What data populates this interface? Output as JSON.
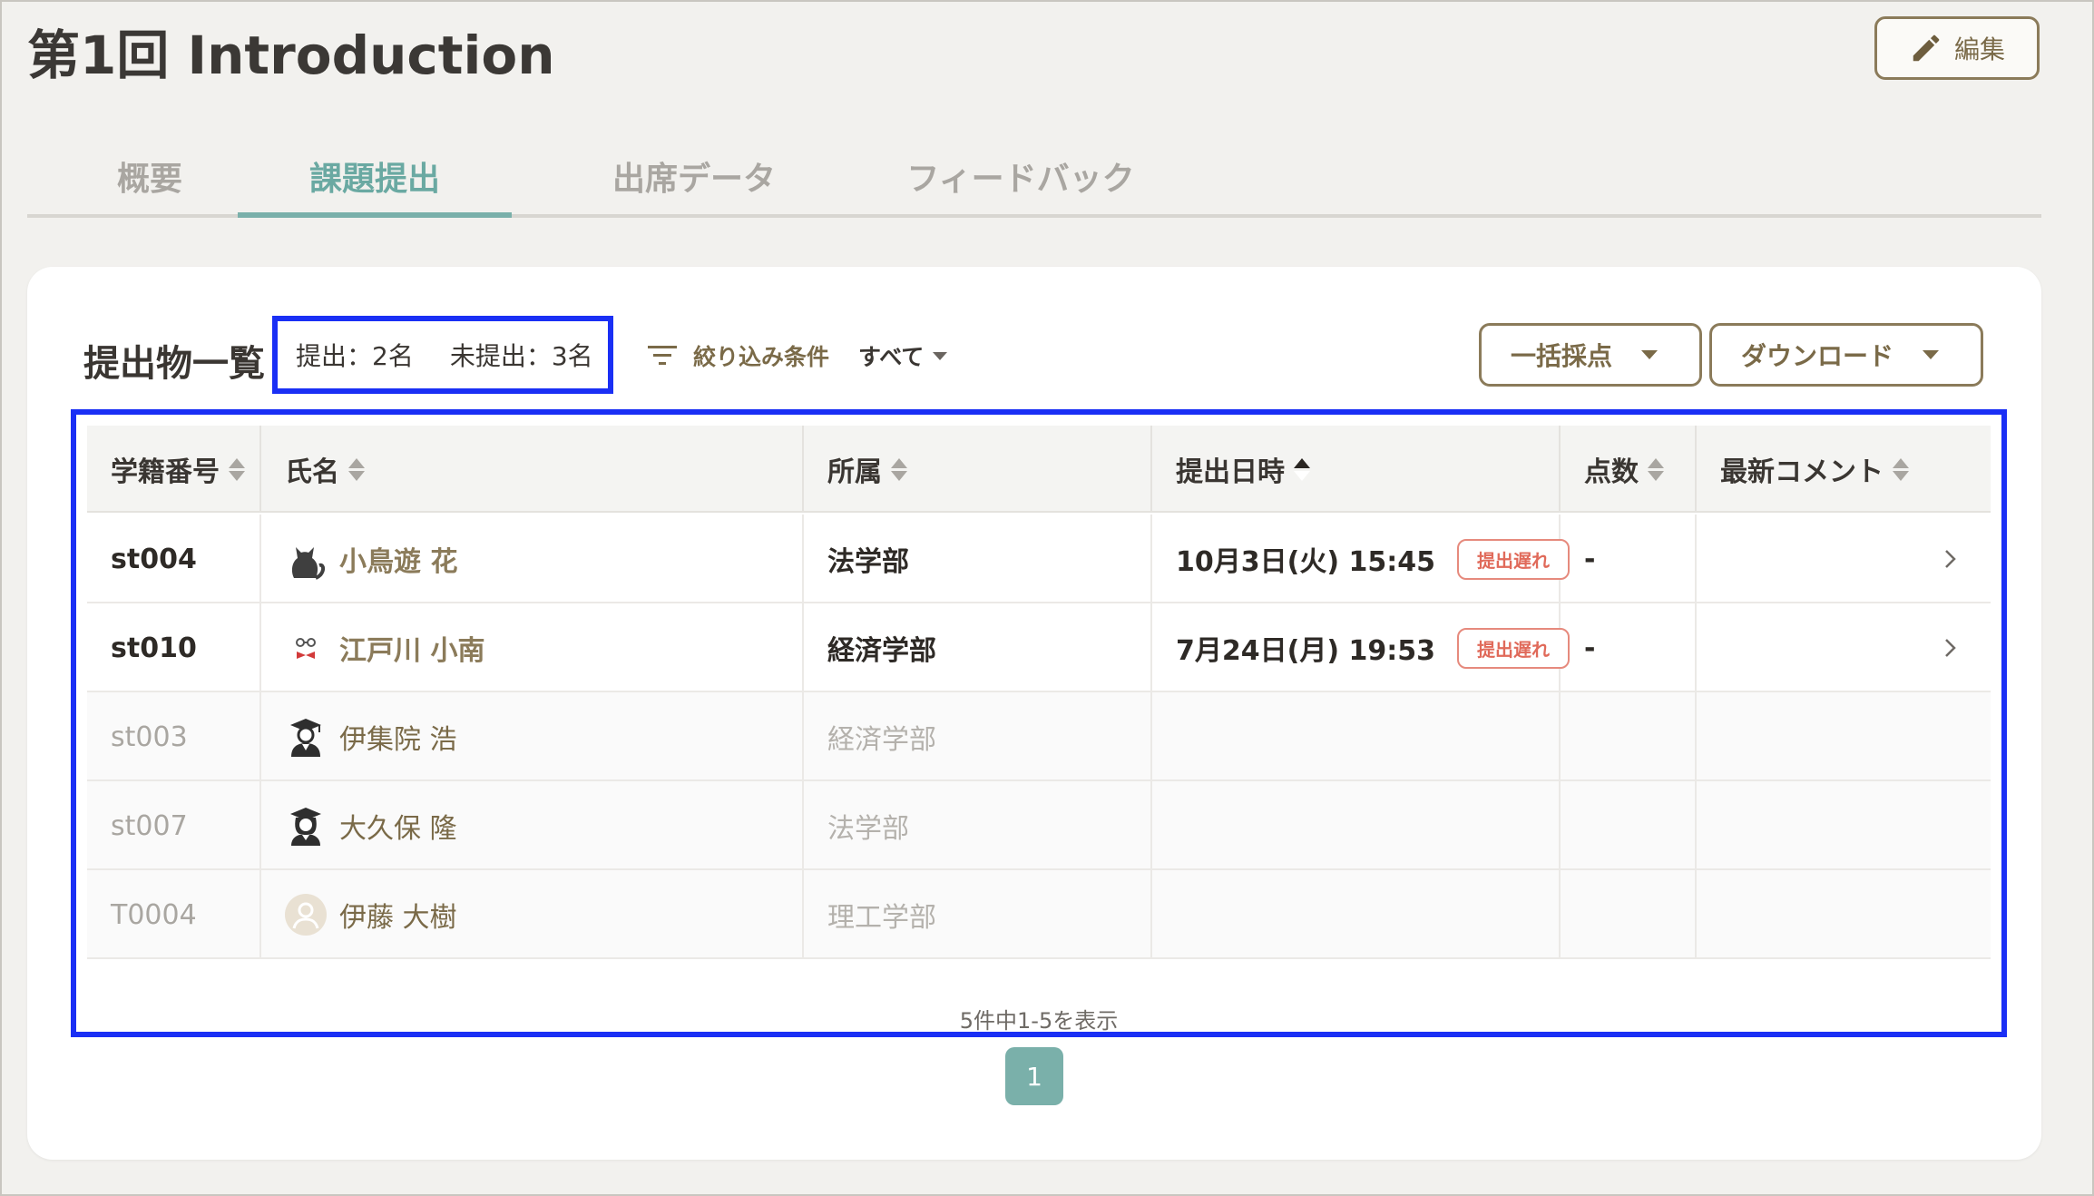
{
  "page": {
    "title": "第1回 Introduction",
    "edit_label": "編集"
  },
  "tabs": [
    {
      "label": "概要"
    },
    {
      "label": "課題提出"
    },
    {
      "label": "出席データ"
    },
    {
      "label": "フィードバック"
    }
  ],
  "list": {
    "title": "提出物一覧",
    "submitted": "提出：2名",
    "not_submitted": "未提出：3名",
    "filter_label": "絞り込み条件",
    "filter_value": "すべて",
    "bulk_grade_label": "一括採点",
    "download_label": "ダウンロード"
  },
  "table": {
    "columns": [
      "学籍番号",
      "氏名",
      "所属",
      "提出日時",
      "点数",
      "最新コメント"
    ],
    "rows": [
      {
        "id": "st004",
        "name": "小鳥遊 花",
        "dept": "法学部",
        "date": "10月3日(火) 15:45",
        "badge": "提出遅れ",
        "score": "-",
        "submitted": true,
        "avatar": "cat-icon"
      },
      {
        "id": "st010",
        "name": "江戸川 小南",
        "dept": "経済学部",
        "date": "7月24日(月) 19:53",
        "badge": "提出遅れ",
        "score": "-",
        "submitted": true,
        "avatar": "glasses-bowtie-icon"
      },
      {
        "id": "st003",
        "name": "伊集院 浩",
        "dept": "経済学部",
        "date": "",
        "badge": "",
        "score": "",
        "submitted": false,
        "avatar": "graduate-icon"
      },
      {
        "id": "st007",
        "name": "大久保 隆",
        "dept": "法学部",
        "date": "",
        "badge": "",
        "score": "",
        "submitted": false,
        "avatar": "graduate-female-icon"
      },
      {
        "id": "T0004",
        "name": "伊藤 大樹",
        "dept": "理工学部",
        "date": "",
        "badge": "",
        "score": "",
        "submitted": false,
        "avatar": "default-user-icon"
      }
    ],
    "footer": "5件中1-5を表示"
  },
  "pagination": {
    "current": "1"
  },
  "colors": {
    "accent": "#7ab0aa",
    "brand_brown": "#8b7b5a",
    "late_red": "#e06a5a",
    "highlight_blue": "#1a2ff5"
  }
}
